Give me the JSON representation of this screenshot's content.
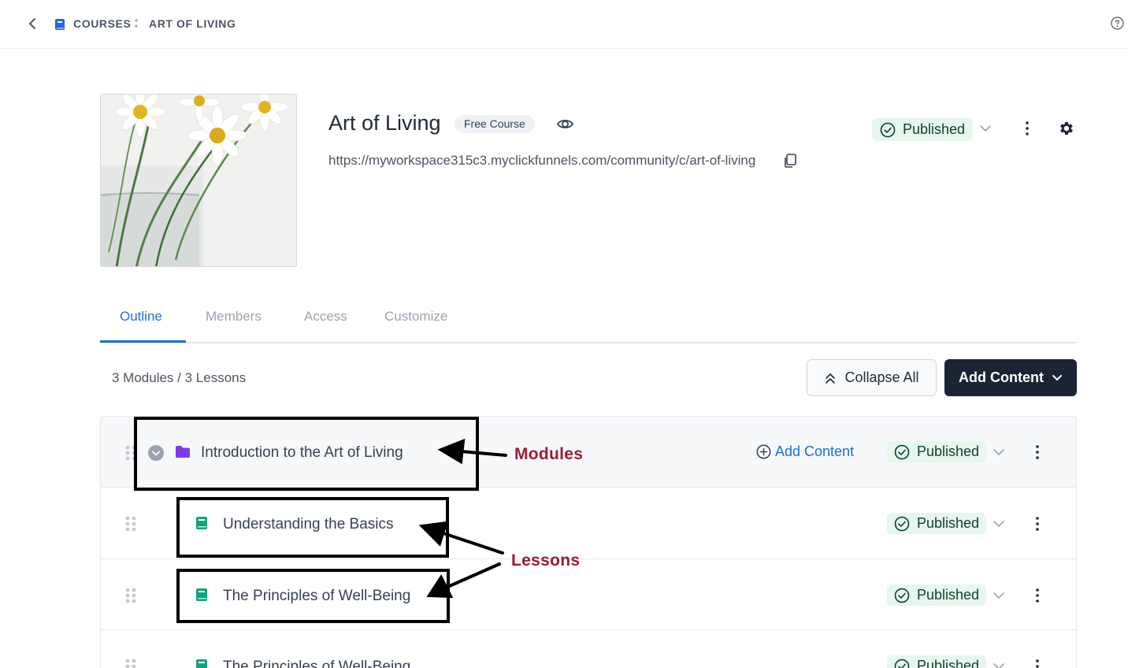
{
  "breadcrumb": {
    "root": "COURSES",
    "current": "ART OF LIVING"
  },
  "course": {
    "title": "Art of Living",
    "badge": "Free Course",
    "url": "https://myworkspace315c3.myclickfunnels.com/community/c/art-of-living",
    "status": "Published"
  },
  "tabs": [
    {
      "label": "Outline",
      "active": true
    },
    {
      "label": "Members",
      "active": false
    },
    {
      "label": "Access",
      "active": false
    },
    {
      "label": "Customize",
      "active": false
    }
  ],
  "outline": {
    "summary": "3 Modules / 3 Lessons",
    "collapse_label": "Collapse All",
    "add_content_label": "Add Content"
  },
  "rows": [
    {
      "type": "module",
      "title": "Introduction to the Art of Living",
      "action": "Add Content",
      "status": "Published"
    },
    {
      "type": "lesson",
      "title": "Understanding the Basics",
      "status": "Published"
    },
    {
      "type": "lesson",
      "title": "The Principles of Well-Being",
      "status": "Published"
    },
    {
      "type": "lesson",
      "title": "The Principles of Well-Being",
      "status": "Published"
    }
  ],
  "annotations": {
    "modules": "Modules",
    "lessons": "Lessons"
  },
  "colors": {
    "accent": "#1d6fd1",
    "dark_button": "#1a2434",
    "published_bg": "#e6f7ee",
    "annotation": "#9b1c31",
    "module_icon": "#7c3aed",
    "lesson_icon": "#10a37f"
  },
  "icons": [
    "chevron-left-icon",
    "book-icon",
    "help-icon",
    "eye-icon",
    "copy-icon",
    "check-circle-icon",
    "chevron-down-icon",
    "kebab-icon",
    "gear-icon",
    "chevrons-up-icon",
    "drag-handle-icon",
    "collapse-toggle-icon",
    "folder-icon",
    "plus-circle-icon"
  ]
}
